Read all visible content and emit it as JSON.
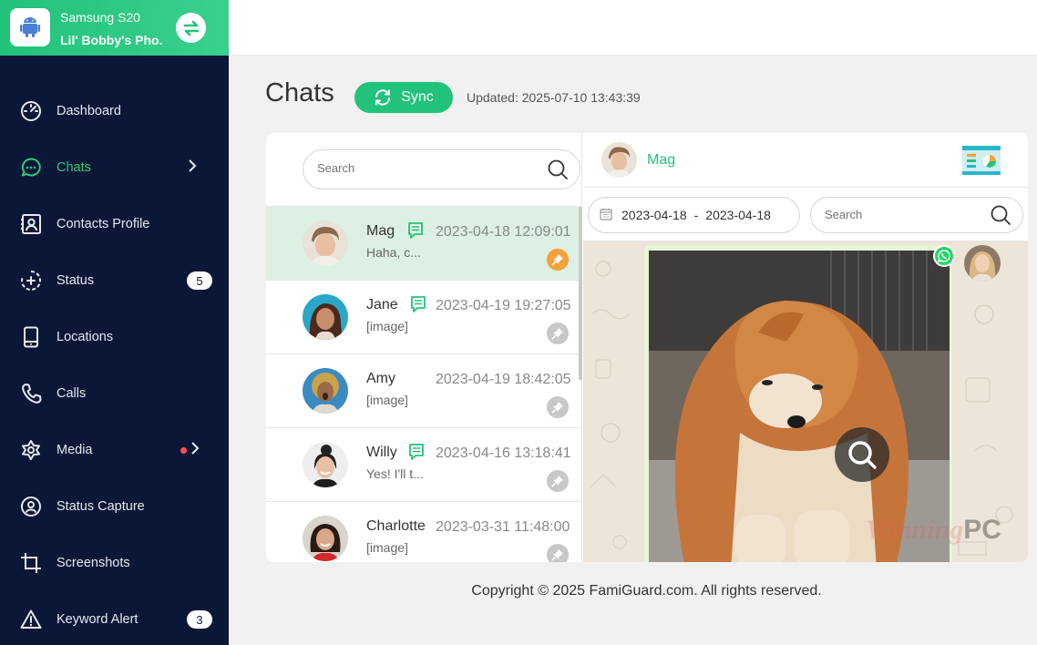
{
  "device": {
    "name": "Samsung S20",
    "owner": "Lil' Bobby's Pho..."
  },
  "sidebar": {
    "items": [
      {
        "label": "Dashboard",
        "icon": "dashboard-icon"
      },
      {
        "label": "Chats",
        "icon": "chat-bubble-icon",
        "active": true
      },
      {
        "label": "Contacts Profile",
        "icon": "contact-card-icon"
      },
      {
        "label": "Status",
        "icon": "status-icon",
        "badge": "5"
      },
      {
        "label": "Locations",
        "icon": "phone-icon"
      },
      {
        "label": "Calls",
        "icon": "call-icon"
      },
      {
        "label": "Media",
        "icon": "media-icon"
      },
      {
        "label": "Status Capture",
        "icon": "status-capture-icon"
      },
      {
        "label": "Screenshots",
        "icon": "crop-icon"
      },
      {
        "label": "Keyword Alert",
        "icon": "warning-icon",
        "badge": "3"
      }
    ]
  },
  "header": {
    "title": "Chats",
    "sync_label": "Sync",
    "updated": "Updated: 2025-07-10 13:43:39"
  },
  "chat_list": {
    "search_placeholder": "Search",
    "chats": [
      {
        "name": "Mag",
        "time": "2023-04-18 12:09:01",
        "preview": "Haha, c...",
        "pinned": true,
        "has_note_icon": true
      },
      {
        "name": "Jane",
        "time": "2023-04-19 19:27:05",
        "preview": "[image]",
        "pinned": false,
        "has_note_icon": true
      },
      {
        "name": "Amy",
        "time": "2023-04-19 18:42:05",
        "preview": "[image]",
        "pinned": false,
        "has_note_icon": false
      },
      {
        "name": "Willy",
        "time": "2023-04-16 13:18:41",
        "preview": "Yes! I'll t...",
        "pinned": false,
        "has_note_icon": true
      },
      {
        "name": "Charlotte",
        "time": "2023-03-31 11:48:00",
        "preview": "[image]",
        "pinned": false,
        "has_note_icon": false
      }
    ]
  },
  "conversation": {
    "contact_name": "Mag",
    "date_from": "2023-04-18",
    "date_sep": "-",
    "date_to": "2023-04-18",
    "search_placeholder": "Search",
    "watermark_script": "Winning",
    "watermark_bold": "PC"
  },
  "footer": {
    "text": "Copyright © 2025 FamiGuard.com. All rights reserved."
  },
  "colors": {
    "accent": "#22c27a",
    "sidebar": "#0b1736",
    "pin_active": "#f6a13a"
  }
}
